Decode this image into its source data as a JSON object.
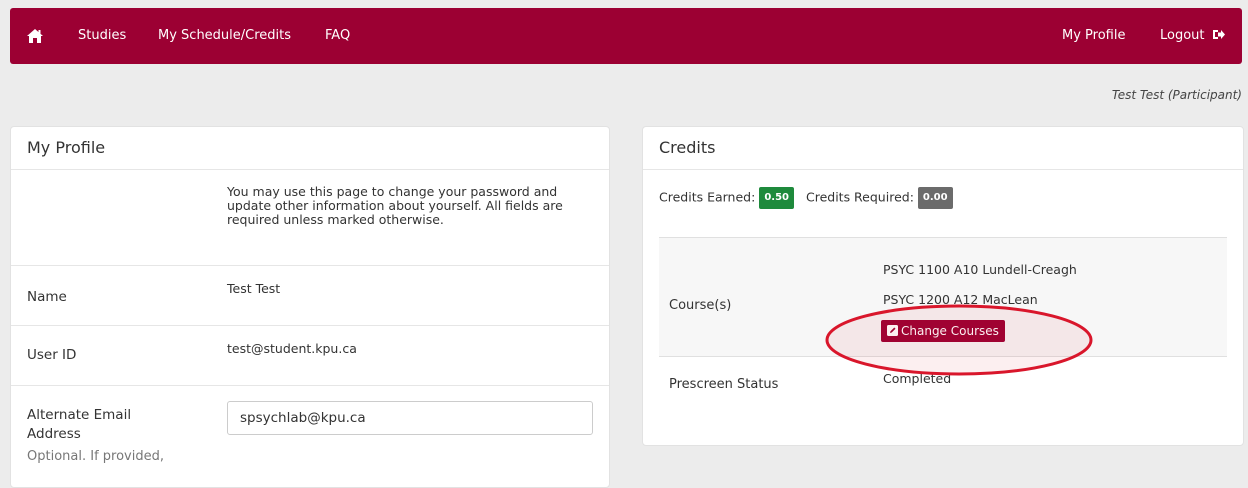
{
  "nav": {
    "home_icon": "home-icon",
    "items": [
      "Studies",
      "My Schedule/Credits",
      "FAQ"
    ],
    "my_profile": "My Profile",
    "logout": "Logout",
    "logout_icon": "sign-out-icon",
    "brand_color": "#9c0033"
  },
  "user_display": "Test Test (Participant)",
  "profile": {
    "title": "My Profile",
    "intro": "You may use this page to change your password and update other information about yourself. All fields are required unless marked otherwise.",
    "name_label": "Name",
    "name_value": "Test Test",
    "userid_label": "User ID",
    "userid_value": "test@student.kpu.ca",
    "alt_email_label_1": "Alternate Email",
    "alt_email_label_2": "Address",
    "alt_email_value": "spsychlab@kpu.ca",
    "alt_email_hint": "Optional. If provided,"
  },
  "credits": {
    "title": "Credits",
    "earned_label": "Credits Earned:",
    "earned_value": "0.50",
    "required_label": "Credits Required:",
    "required_value": "0.00",
    "courses_label": "Course(s)",
    "courses": [
      "PSYC 1100 A10 Lundell-Creagh",
      "PSYC 1200 A12 MacLean"
    ],
    "change_courses": "Change Courses",
    "prescreen_label": "Prescreen Status",
    "prescreen_value": "Completed",
    "highlight_color": "#d9162b"
  }
}
